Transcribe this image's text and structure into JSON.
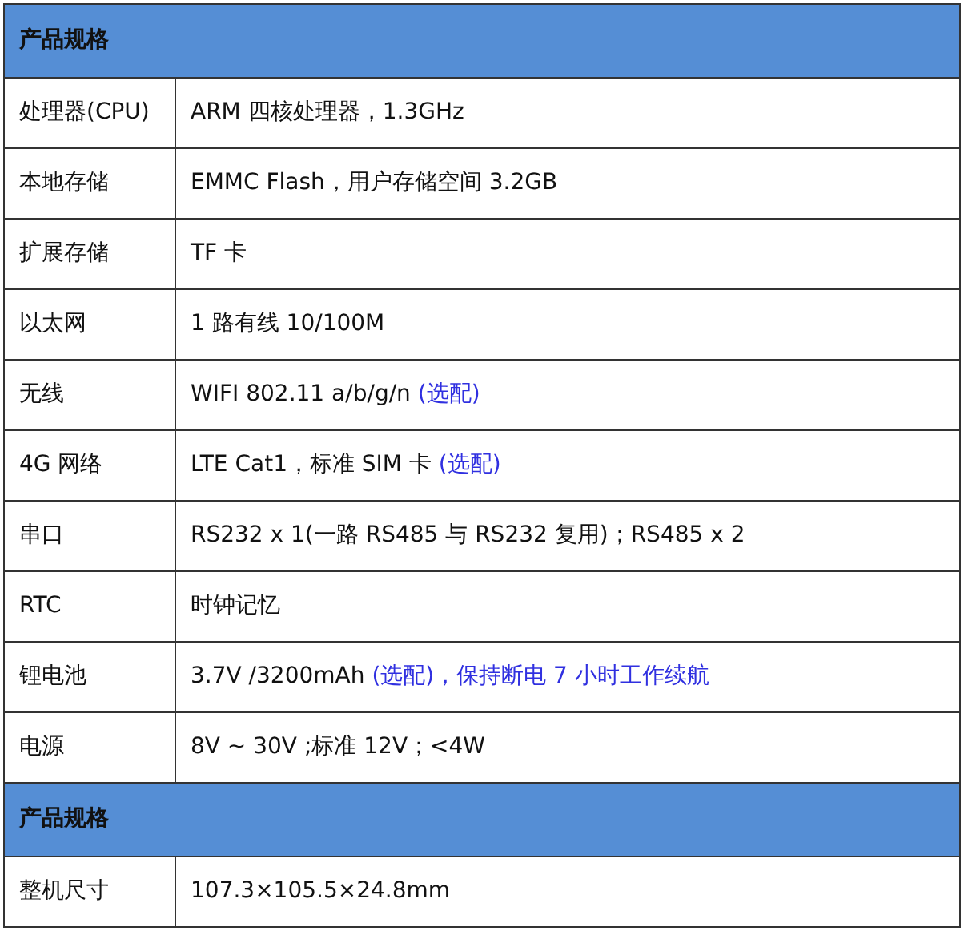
{
  "rows": [
    {
      "kind": "header",
      "label": "产品规格"
    },
    {
      "kind": "row",
      "label": "处理器(CPU)",
      "value": "ARM  四核处理器，1.3GHz"
    },
    {
      "kind": "row",
      "label": "本地存储",
      "value": "EMMC Flash，用户存储空间 3.2GB"
    },
    {
      "kind": "row",
      "label": "扩展存储",
      "value": "TF  卡"
    },
    {
      "kind": "row",
      "label": "以太网",
      "value": "1 路有线 10/100M"
    },
    {
      "kind": "row",
      "label": "无线",
      "value": "WIFI 802.11 a/b/g/n ",
      "note": "(选配)"
    },
    {
      "kind": "row",
      "label": "4G 网络",
      "value": "LTE Cat1，标准 SIM 卡 ",
      "note": "(选配)"
    },
    {
      "kind": "row",
      "label": "串口",
      "value": "RS232 x 1(一路 RS485 与 RS232 复用)；RS485 x 2"
    },
    {
      "kind": "row",
      "label": "RTC",
      "value": "时钟记忆"
    },
    {
      "kind": "row",
      "label": "锂电池",
      "value": "3.7V /3200mAh ",
      "note": "(选配)，保持断电 7 小时工作续航"
    },
    {
      "kind": "row",
      "label": "电源",
      "value": "8V ~ 30V ;标准 12V；<4W"
    },
    {
      "kind": "header",
      "label": "产品规格"
    },
    {
      "kind": "row",
      "label": "整机尺寸",
      "value": "107.3×105.5×24.8mm"
    }
  ]
}
